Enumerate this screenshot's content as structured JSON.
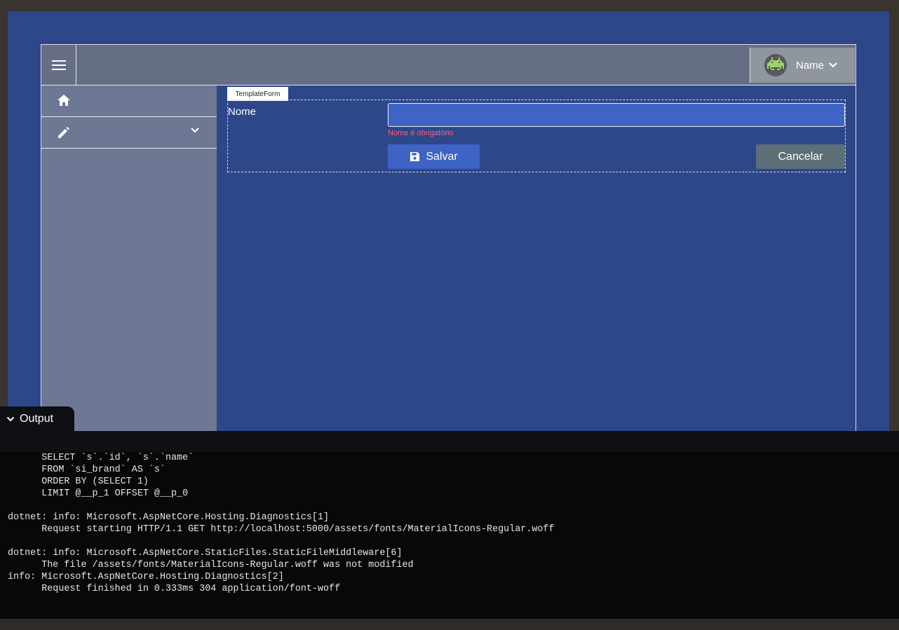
{
  "topbar": {
    "menu_icon": "hamburger-menu-icon",
    "user": {
      "name": "Name",
      "avatar_icon": "space-invader-avatar-icon"
    }
  },
  "sidebar": {
    "items": [
      {
        "icon": "home-icon"
      },
      {
        "icon": "pencil-icon",
        "expandable": true
      }
    ]
  },
  "form": {
    "tag": "TemplateForm",
    "field_label": "Nome",
    "field_value": "",
    "error": "Nome é obrigatório",
    "save_label": "Salvar",
    "cancel_label": "Cancelar"
  },
  "output": {
    "title": "Output",
    "log": "      SELECT `s`.`id`, `s`.`name`\n      FROM `si_brand` AS `s`\n      ORDER BY (SELECT 1)\n      LIMIT @__p_1 OFFSET @__p_0\n\ndotnet: info: Microsoft.AspNetCore.Hosting.Diagnostics[1]\n      Request starting HTTP/1.1 GET http://localhost:5000/assets/fonts/MaterialIcons-Regular.woff\n\ndotnet: info: Microsoft.AspNetCore.StaticFiles.StaticFileMiddleware[6]\n      The file /assets/fonts/MaterialIcons-Regular.woff was not modified\ninfo: Microsoft.AspNetCore.Hosting.Diagnostics[2]\n      Request finished in 0.333ms 304 application/font-woff"
  },
  "colors": {
    "page_background": "#2d4789",
    "topbar": "#656e85",
    "sidebar": "#6d7894",
    "primary_button": "#3f63c5",
    "cancel_button": "#5c6e76",
    "error_text": "#ff5c7a",
    "avatar_accent": "#9bd36a"
  }
}
